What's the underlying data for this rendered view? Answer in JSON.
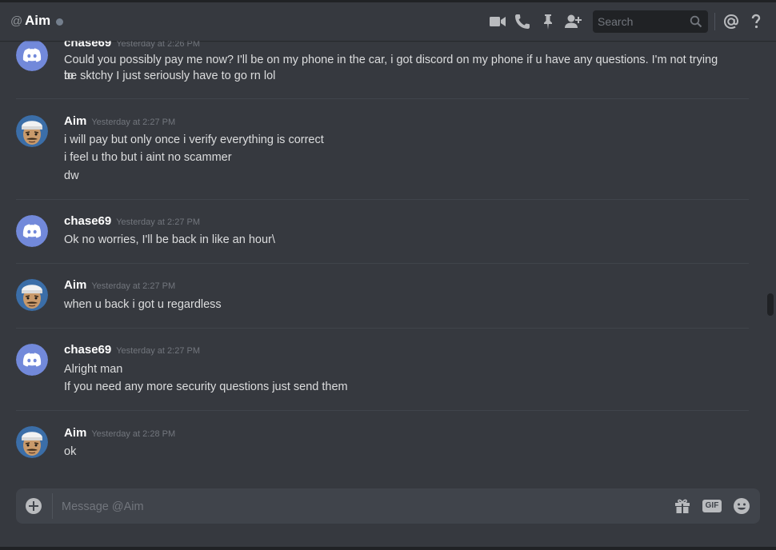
{
  "header": {
    "at_prefix": "@",
    "title": "Aim",
    "search_placeholder": "Search",
    "icons": [
      "video-call-icon",
      "voice-call-icon",
      "pin-icon",
      "add-friend-icon",
      "search-icon",
      "mention-icon",
      "help-icon"
    ]
  },
  "colors": {
    "background": "#36393f",
    "discord_blurple": "#7289da",
    "input": "#40444b",
    "search": "#202225"
  },
  "messages": [
    {
      "author": "chase69",
      "avatar": "discord-default",
      "timestamp": "Yesterday at 2:26 PM",
      "lines": [
        "Could you possibly pay me now? I'll be on my phone in the car, i got discord on my phone if u have any questions. I'm not trying to",
        "be sktchy I just seriously have to go rn lol"
      ]
    },
    {
      "author": "Aim",
      "avatar": "character",
      "timestamp": "Yesterday at 2:27 PM",
      "lines": [
        "i will pay but only once i verify everything is correct",
        "i feel u tho but i aint no scammer",
        "dw"
      ]
    },
    {
      "author": "chase69",
      "avatar": "discord-default",
      "timestamp": "Yesterday at 2:27 PM",
      "lines": [
        "Ok no worries, I'll be back in like an hour\\"
      ]
    },
    {
      "author": "Aim",
      "avatar": "character",
      "timestamp": "Yesterday at 2:27 PM",
      "lines": [
        "when u back i got u regardless"
      ]
    },
    {
      "author": "chase69",
      "avatar": "discord-default",
      "timestamp": "Yesterday at 2:27 PM",
      "lines": [
        "Alright man",
        "If you need any more security questions just send them"
      ]
    },
    {
      "author": "Aim",
      "avatar": "character",
      "timestamp": "Yesterday at 2:28 PM",
      "lines": [
        "ok"
      ]
    }
  ],
  "composer": {
    "placeholder": "Message @Aim",
    "gif_label": "GIF",
    "icons": [
      "upload-plus-icon",
      "gift-icon",
      "gif-icon",
      "emoji-icon"
    ]
  }
}
